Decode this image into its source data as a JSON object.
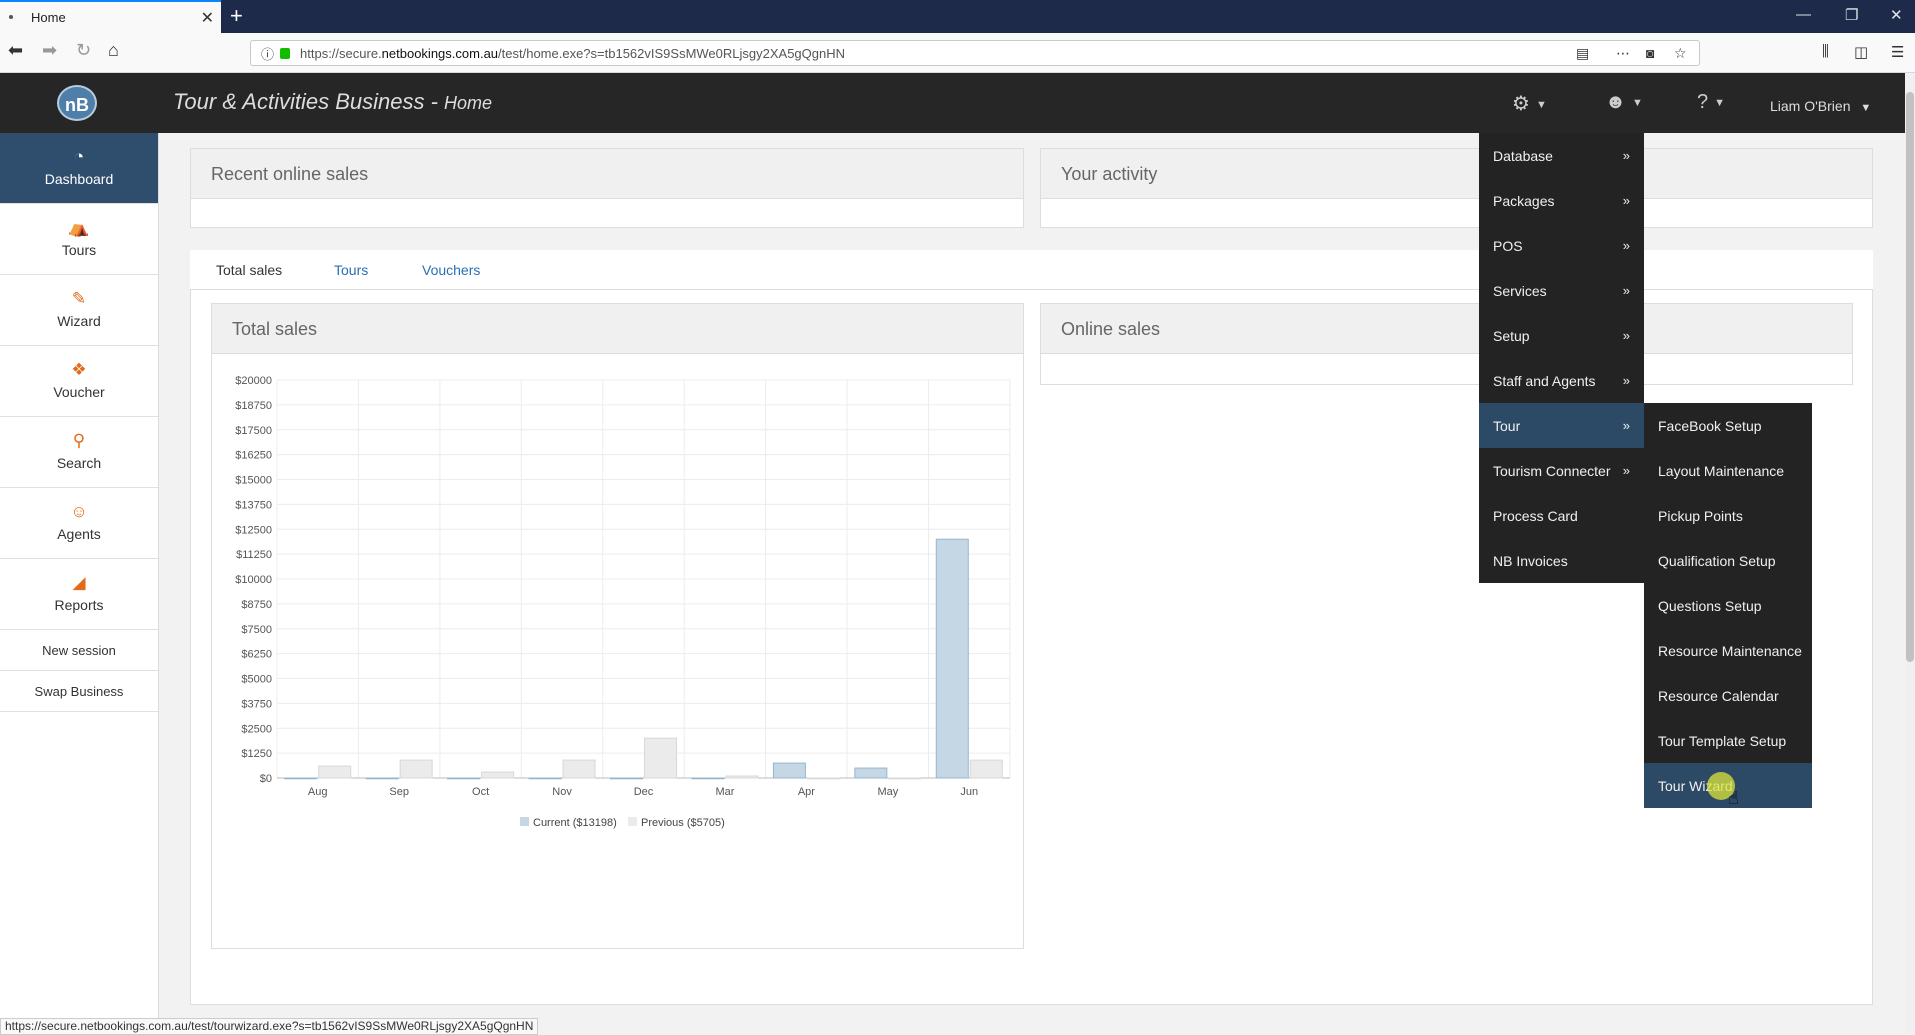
{
  "browser": {
    "tab_title": "Home",
    "url_prefix": "https://secure.",
    "url_domain": "netbookings.com.au",
    "url_rest": "/test/home.exe?s=tb1562vIS9SsMWe0RLjsgy2XA5gQgnHN",
    "status_url": "https://secure.netbookings.com.au/test/tourwizard.exe?s=tb1562vIS9SsMWe0RLjsgy2XA5gQgnHN"
  },
  "header": {
    "title": "Tour & Activities Business - ",
    "subtitle": "Home",
    "logo_text": "nB",
    "user_name": "Liam O'Brien"
  },
  "sidebar": {
    "items": [
      {
        "label": "Dashboard",
        "icon": "dashboard-icon"
      },
      {
        "label": "Tours",
        "icon": "tours-icon"
      },
      {
        "label": "Wizard",
        "icon": "wizard-wand-icon"
      },
      {
        "label": "Voucher",
        "icon": "gift-icon"
      },
      {
        "label": "Search",
        "icon": "search-icon"
      },
      {
        "label": "Agents",
        "icon": "agents-icon"
      },
      {
        "label": "Reports",
        "icon": "reports-chart-icon"
      }
    ],
    "links": [
      "New session",
      "Swap Business"
    ]
  },
  "panels": {
    "recent_online_sales": "Recent online sales",
    "your_activity": "Your activity",
    "total_sales": "Total sales",
    "online_sales": "Online sales"
  },
  "content_tabs": [
    "Total sales",
    "Tours",
    "Vouchers"
  ],
  "main_menu": {
    "items": [
      {
        "label": "Database",
        "arrow": "»"
      },
      {
        "label": "Packages",
        "arrow": "»"
      },
      {
        "label": "POS",
        "arrow": "»"
      },
      {
        "label": "Services",
        "arrow": "»"
      },
      {
        "label": "Setup",
        "arrow": "»"
      },
      {
        "label": "Staff and Agents",
        "arrow": "»"
      },
      {
        "label": "Tour",
        "arrow": "»"
      },
      {
        "label": "Tourism Connecter",
        "arrow": "»"
      },
      {
        "label": "Process Card",
        "arrow": ""
      },
      {
        "label": "NB Invoices",
        "arrow": ""
      }
    ]
  },
  "tour_submenu": {
    "items": [
      "FaceBook Setup",
      "Layout Maintenance",
      "Pickup Points",
      "Qualification Setup",
      "Questions Setup",
      "Resource Maintenance",
      "Resource Calendar",
      "Tour Template Setup",
      "Tour Wizard"
    ]
  },
  "colors": {
    "current_series": "#c5d7e4",
    "previous_series": "#ebebeb",
    "sidebar_active": "#2f4e6d",
    "menu_bg": "#232323",
    "menu_active": "#2c4a66"
  },
  "chart_data": {
    "type": "bar",
    "title": "Total sales",
    "categories": [
      "Aug",
      "Sep",
      "Oct",
      "Nov",
      "Dec",
      "Mar",
      "Apr",
      "May",
      "Jun"
    ],
    "y_ticks": [
      "$20000",
      "$18750",
      "$17500",
      "$16250",
      "$15000",
      "$13750",
      "$12500",
      "$11250",
      "$10000",
      "$8750",
      "$7500",
      "$6250",
      "$5000",
      "$3750",
      "$2500",
      "$1250",
      "$0"
    ],
    "ylim": [
      0,
      20000
    ],
    "grid": true,
    "legend_position": "bottom",
    "series": [
      {
        "name": "Current ($13198)",
        "values": [
          0,
          0,
          0,
          0,
          0,
          0,
          750,
          500,
          12000
        ]
      },
      {
        "name": "Previous ($5705)",
        "values": [
          600,
          900,
          300,
          900,
          2000,
          100,
          0,
          0,
          900
        ]
      }
    ]
  }
}
